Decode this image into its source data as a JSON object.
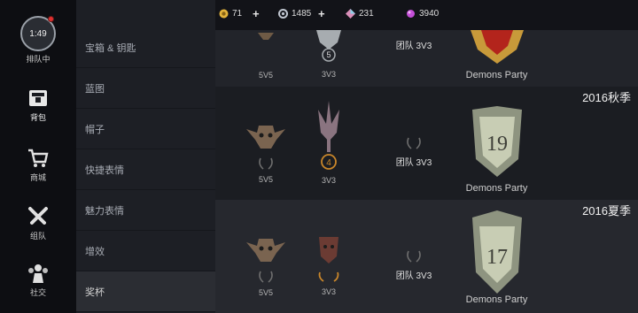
{
  "rail": {
    "timer": "1:49",
    "queue_label": "排队中",
    "items": [
      {
        "label": "背包",
        "icon": "backpack-icon"
      },
      {
        "label": "商城",
        "icon": "shopping-cart-icon"
      },
      {
        "label": "组队",
        "icon": "crossed-swords-icon"
      },
      {
        "label": "社交",
        "icon": "people-icon"
      }
    ]
  },
  "menu": {
    "items": [
      "宝箱 & 钥匙",
      "蓝图",
      "帽子",
      "快捷表情",
      "魅力表情",
      "增效",
      "奖杯"
    ]
  },
  "currency": {
    "gold": "71",
    "gems": "1485",
    "crystals": "231",
    "shards": "3940",
    "plus": "+"
  },
  "rows": [
    {
      "season": "",
      "solo_label": "5V5",
      "trio_label": "3V3",
      "trio_count": "5",
      "team_label": "团队 3V3",
      "party_label": "Demons Party"
    },
    {
      "season": "2016秋季",
      "solo_label": "5V5",
      "trio_label": "3V3",
      "trio_count": "4",
      "team_label": "团队 3V3",
      "party_label": "Demons Party",
      "rank": "19"
    },
    {
      "season": "2016夏季",
      "solo_label": "5V5",
      "trio_label": "3V3",
      "team_label": "团队 3V3",
      "party_label": "Demons Party",
      "rank": "17"
    }
  ]
}
